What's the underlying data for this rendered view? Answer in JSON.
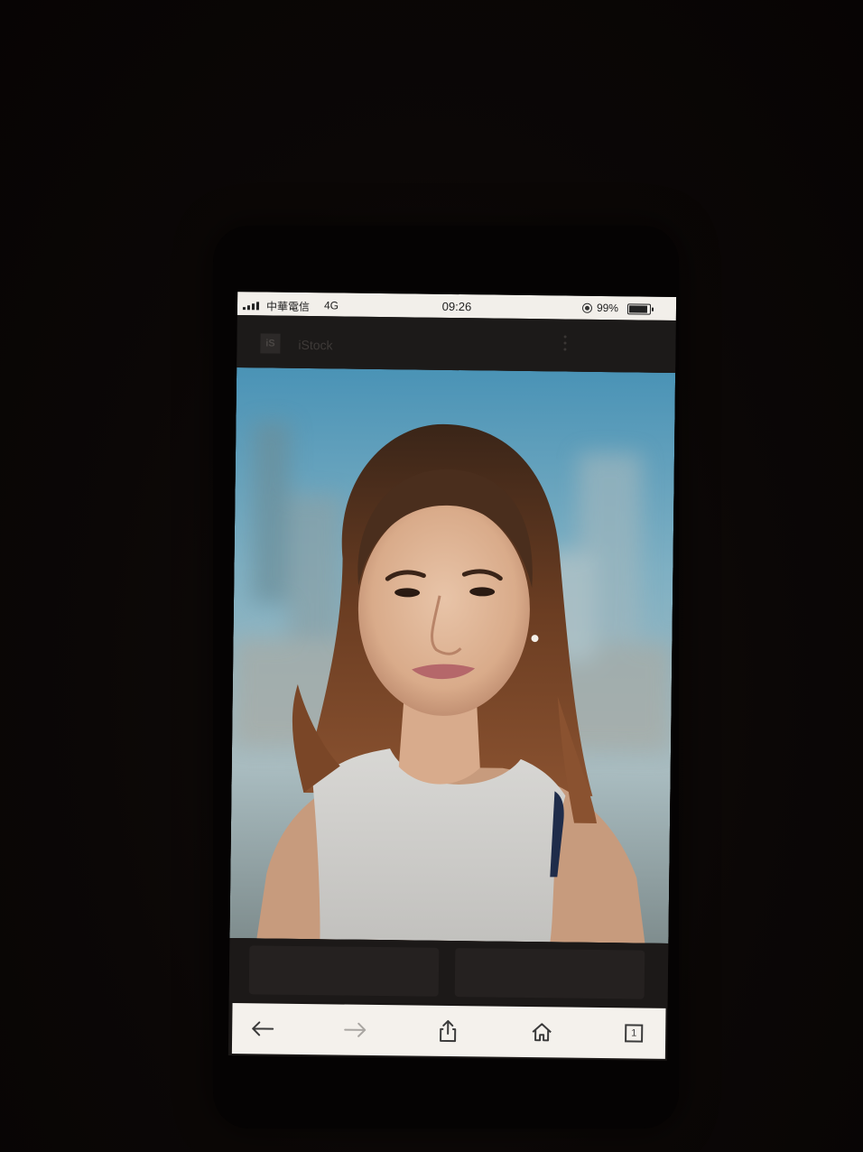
{
  "status_bar": {
    "carrier": "中華電信",
    "network": "4G",
    "time": "09:26",
    "battery": "99%",
    "battery_level": 0.99
  },
  "site": {
    "logo_text": "iS",
    "name": "iStock"
  },
  "toolbar": {
    "tab_count": "1"
  },
  "colors": {
    "status_bar_bg": "#f2efea",
    "toolbar_bg": "#f4f1ec",
    "disabled_icon": "#a9a6a2",
    "enabled_icon": "#3a3a3a"
  }
}
